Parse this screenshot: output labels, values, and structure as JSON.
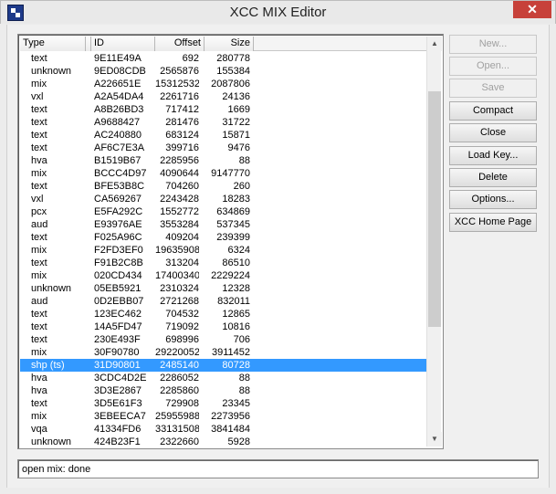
{
  "window": {
    "title": "XCC MIX Editor",
    "close_glyph": "✕"
  },
  "columns": [
    "Type",
    "ID",
    "Offset",
    "Size"
  ],
  "rows": [
    {
      "type": "text",
      "id": "9E11E49A",
      "offset": "692",
      "size": "280778"
    },
    {
      "type": "unknown",
      "id": "9ED08CDB",
      "offset": "2565876",
      "size": "155384"
    },
    {
      "type": "mix",
      "id": "A226651E",
      "offset": "15312532",
      "size": "2087806"
    },
    {
      "type": "vxl",
      "id": "A2A54DA4",
      "offset": "2261716",
      "size": "24136"
    },
    {
      "type": "text",
      "id": "A8B26BD3",
      "offset": "717412",
      "size": "1669"
    },
    {
      "type": "text",
      "id": "A9688427",
      "offset": "281476",
      "size": "31722"
    },
    {
      "type": "text",
      "id": "AC240880",
      "offset": "683124",
      "size": "15871"
    },
    {
      "type": "text",
      "id": "AF6C7E3A",
      "offset": "399716",
      "size": "9476"
    },
    {
      "type": "hva",
      "id": "B1519B67",
      "offset": "2285956",
      "size": "88"
    },
    {
      "type": "mix",
      "id": "BCCC4D97",
      "offset": "4090644",
      "size": "9147770"
    },
    {
      "type": "text",
      "id": "BFE53B8C",
      "offset": "704260",
      "size": "260"
    },
    {
      "type": "vxl",
      "id": "CA569267",
      "offset": "2243428",
      "size": "18283"
    },
    {
      "type": "pcx",
      "id": "E5FA292C",
      "offset": "1552772",
      "size": "634869"
    },
    {
      "type": "aud",
      "id": "E93976AE",
      "offset": "3553284",
      "size": "537345"
    },
    {
      "type": "text",
      "id": "F025A96C",
      "offset": "409204",
      "size": "239399"
    },
    {
      "type": "mix",
      "id": "F2FD3EF0",
      "offset": "19635908",
      "size": "6324"
    },
    {
      "type": "text",
      "id": "F91B2C8B",
      "offset": "313204",
      "size": "86510"
    },
    {
      "type": "mix",
      "id": "020CD434",
      "offset": "17400340",
      "size": "2229224"
    },
    {
      "type": "unknown",
      "id": "05EB5921",
      "offset": "2310324",
      "size": "12328"
    },
    {
      "type": "aud",
      "id": "0D2EBB07",
      "offset": "2721268",
      "size": "832011"
    },
    {
      "type": "text",
      "id": "123EC462",
      "offset": "704532",
      "size": "12865"
    },
    {
      "type": "text",
      "id": "14A5FD47",
      "offset": "719092",
      "size": "10816"
    },
    {
      "type": "text",
      "id": "230E493F",
      "offset": "698996",
      "size": "706"
    },
    {
      "type": "mix",
      "id": "30F90780",
      "offset": "29220052",
      "size": "3911452"
    },
    {
      "type": "shp (ts)",
      "id": "31D90801",
      "offset": "2485140",
      "size": "80728",
      "selected": true
    },
    {
      "type": "hva",
      "id": "3CDC4D2E",
      "offset": "2286052",
      "size": "88"
    },
    {
      "type": "hva",
      "id": "3D3E2867",
      "offset": "2285860",
      "size": "88"
    },
    {
      "type": "text",
      "id": "3D5E61F3",
      "offset": "729908",
      "size": "23345"
    },
    {
      "type": "mix",
      "id": "3EBEECA7",
      "offset": "25955988",
      "size": "2273956"
    },
    {
      "type": "vqa",
      "id": "41334FD6",
      "offset": "33131508",
      "size": "3841484"
    },
    {
      "type": "unknown",
      "id": "424B23F1",
      "offset": "2322660",
      "size": "5928"
    }
  ],
  "buttons": [
    {
      "label": "New...",
      "enabled": false
    },
    {
      "label": "Open...",
      "enabled": false
    },
    {
      "label": "Save",
      "enabled": false
    },
    {
      "label": "Compact",
      "enabled": true
    },
    {
      "label": "Close",
      "enabled": true
    },
    {
      "label": "Load Key...",
      "enabled": true
    },
    {
      "label": "Delete",
      "enabled": true
    },
    {
      "label": "Options...",
      "enabled": true
    },
    {
      "label": "XCC Home Page",
      "enabled": true
    }
  ],
  "status_text": "open mix: done",
  "colors": {
    "selection": "#3399ff",
    "close_button": "#c7413a",
    "disabled_text": "#a0a0a0"
  }
}
